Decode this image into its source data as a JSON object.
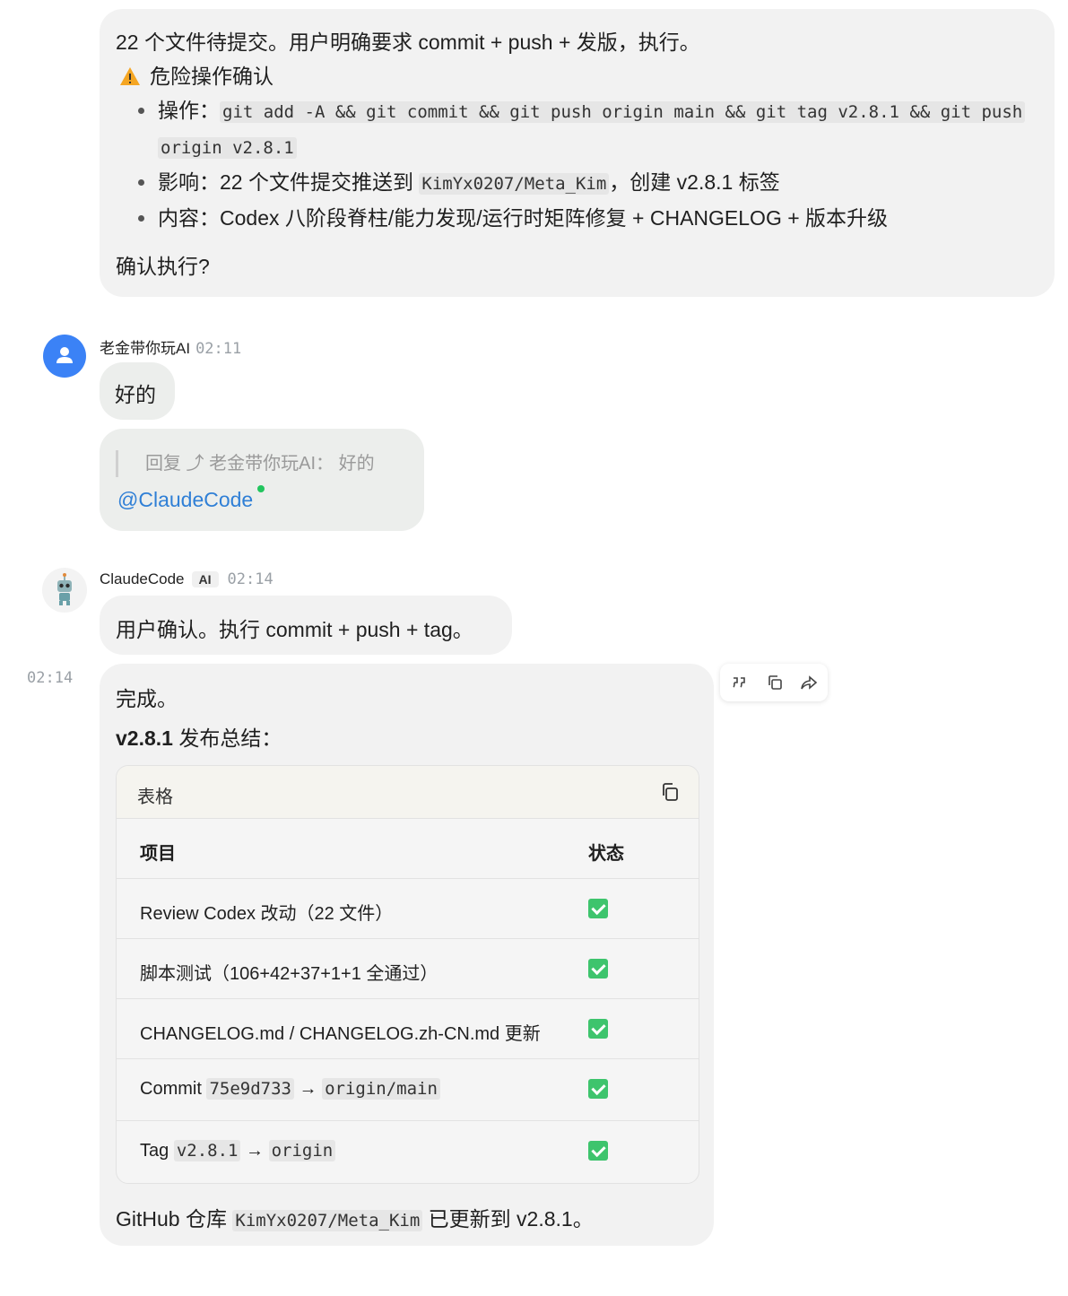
{
  "msg1": {
    "line1": "22 个文件待提交。用户明确要求 commit + push + 发版，执行。",
    "warn_icon": "warning-icon",
    "warn_title": "危险操作确认",
    "op_label": "操作：",
    "op_code_1": "git add -A && git commit && git push origin main && git tag v2.8.1 && git push",
    "op_code_2": "origin v2.8.1",
    "impact_label": "影响：22 个文件提交推送到 ",
    "impact_code": "KimYx0207/Meta_Kim",
    "impact_rest": "，创建 v2.8.1 标签",
    "content_line": "内容：Codex 八阶段脊柱/能力发现/运行时矩阵修复 + CHANGELOG + 版本升级",
    "confirm": "确认执行?"
  },
  "user_msg": {
    "name": "老金带你玩AI",
    "time": "02:11",
    "text": "好的",
    "reply_quote": "回复 ⤴ 老金带你玩AI： 好的",
    "mention": "@ClaudeCode"
  },
  "bot_msg": {
    "name": "ClaudeCode",
    "badge": "AI",
    "time": "02:14",
    "text": "用户确认。执行 commit + push + tag。"
  },
  "bot_msg2": {
    "side_time": "02:14",
    "done": "完成。",
    "summary_bold": "v2.8.1",
    "summary_rest": " 发布总结：",
    "table_title": "表格",
    "col_item": "项目",
    "col_status": "状态",
    "rows": [
      {
        "item": "Review Codex 改动（22 文件）"
      },
      {
        "item": "脚本测试（106+42+37+1+1 全通过）"
      },
      {
        "item": "CHANGELOG.md / CHANGELOG.zh-CN.md 更新"
      },
      {
        "item_pre": "Commit ",
        "code1": "75e9d733",
        "arrow": " → ",
        "code2": "origin/main"
      },
      {
        "item_pre": "Tag ",
        "code1": "v2.8.1",
        "arrow": " → ",
        "code2": "origin"
      }
    ],
    "footer_pre": "GitHub 仓库 ",
    "footer_code": "KimYx0207/Meta_Kim",
    "footer_post": " 已更新到 v2.8.1。"
  },
  "colors": {
    "bubble": "#f2f2f2",
    "user_avatar": "#3b82f6",
    "mention": "#2f7fd6",
    "check": "#3ec46d"
  }
}
